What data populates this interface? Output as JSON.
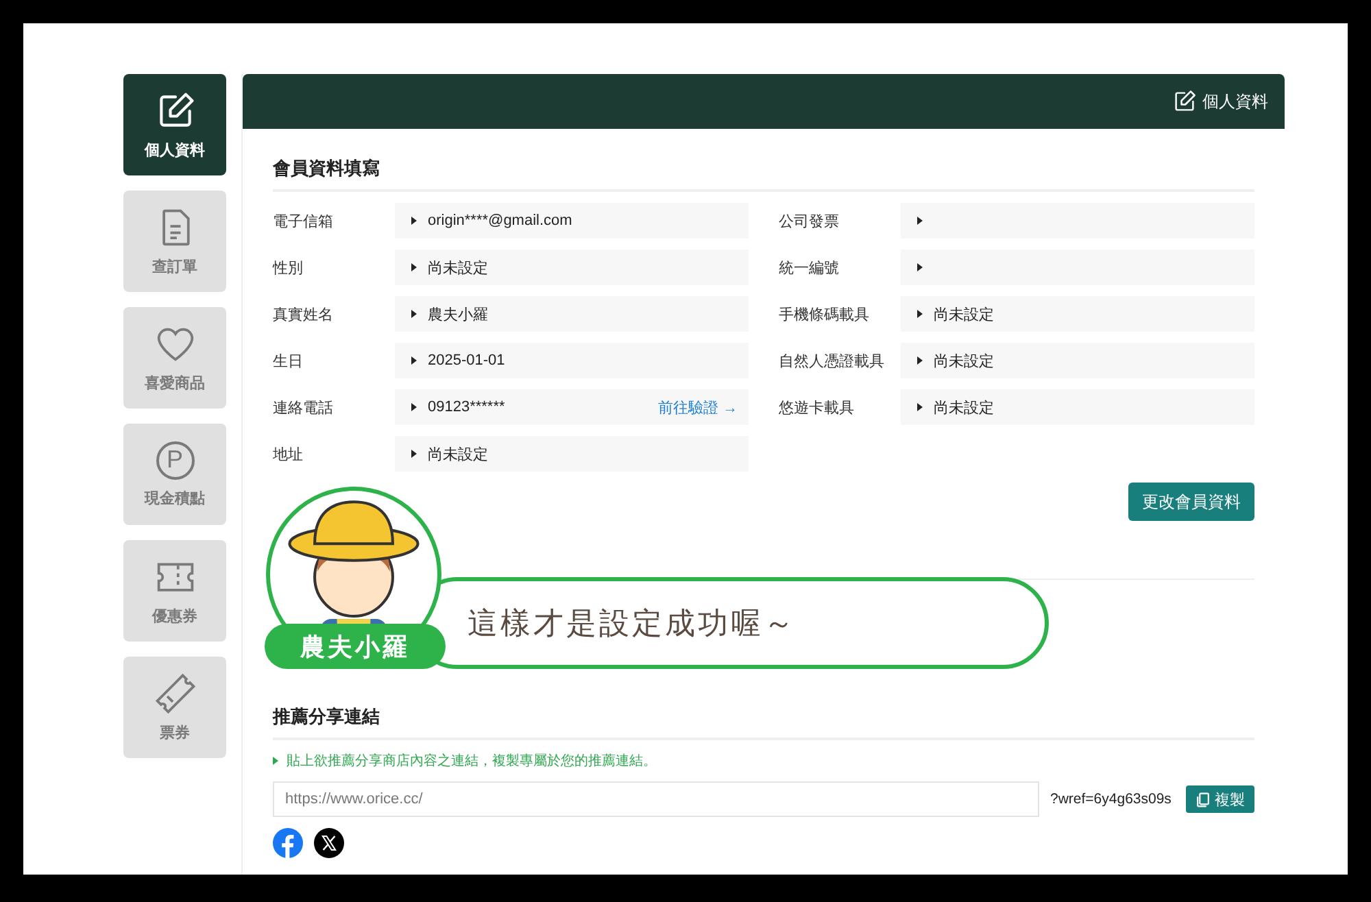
{
  "sidebar": [
    {
      "kind": "profile",
      "label": "個人資料",
      "selected": true
    },
    {
      "kind": "orders",
      "label": "查訂單",
      "selected": false
    },
    {
      "kind": "favorites",
      "label": "喜愛商品",
      "selected": false
    },
    {
      "kind": "points",
      "glyph": "P",
      "label": "現金積點",
      "selected": false
    },
    {
      "kind": "coupons",
      "label": "優惠券",
      "selected": false
    },
    {
      "kind": "tickets",
      "label": "票券",
      "selected": false
    }
  ],
  "header": {
    "title": "個人資料"
  },
  "member_form": {
    "title": "會員資料填寫",
    "left_fields": [
      {
        "label": "電子信箱",
        "value": "origin****@gmail.com"
      },
      {
        "label": "性別",
        "value": "尚未設定"
      },
      {
        "label": "真實姓名",
        "value": "農夫小羅"
      },
      {
        "label": "生日",
        "value": "2025-01-01"
      },
      {
        "label": "連絡電話",
        "value": "09123******",
        "link": "前往驗證 →"
      },
      {
        "label": "地址",
        "value": "尚未設定"
      }
    ],
    "right_fields": [
      {
        "label": "公司發票"
      },
      {
        "label": "統一編號"
      },
      {
        "label": "手機條碼載具",
        "value": "尚未設定"
      },
      {
        "label": "自然人憑證載具",
        "value": "尚未設定"
      },
      {
        "label": "悠遊卡載具",
        "value": "尚未設定"
      }
    ],
    "button": "更改會員資料"
  },
  "callout": {
    "name": "農夫小羅",
    "message": "這樣才是設定成功喔～"
  },
  "referral": {
    "title": "推薦分享連結",
    "hint": "貼上欲推薦分享商店內容之連結，複製專屬於您的推薦連結。",
    "placeholder": "https://www.orice.cc/",
    "suffix": "?wref=6y4g63s09s",
    "copy_button": "複製",
    "share": [
      {
        "kind": "facebook"
      },
      {
        "kind": "x"
      }
    ]
  }
}
